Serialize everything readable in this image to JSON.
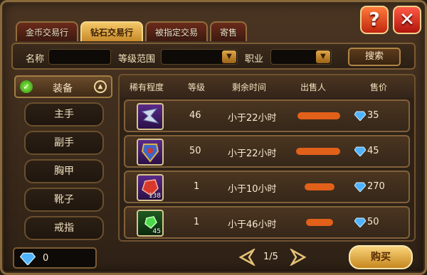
{
  "tabs": [
    {
      "label": "金币交易行",
      "active": false
    },
    {
      "label": "钻石交易行",
      "active": true
    },
    {
      "label": "被指定交易",
      "active": false
    },
    {
      "label": "寄售",
      "active": false
    }
  ],
  "top_buttons": {
    "help": "?",
    "close": "✕"
  },
  "search": {
    "name_label": "名称",
    "name_value": "",
    "level_label": "等级范围",
    "level_value": "",
    "job_label": "职业",
    "job_value": "",
    "search_button": "搜索"
  },
  "sidebar": {
    "category": "装备",
    "items": [
      "主手",
      "副手",
      "胸甲",
      "靴子",
      "戒指"
    ]
  },
  "table": {
    "headers": [
      "稀有程度",
      "等级",
      "剩余时间",
      "出售人",
      "售价"
    ],
    "rows": [
      {
        "icon": "blade-icon",
        "icon_count": "",
        "level": "46",
        "time": "小于22小时",
        "price": "35"
      },
      {
        "icon": "armor-icon",
        "icon_count": "",
        "level": "50",
        "time": "小于22小时",
        "price": "45"
      },
      {
        "icon": "ruby-icon",
        "icon_count": "138",
        "level": "1",
        "time": "小于10小时",
        "price": "270"
      },
      {
        "icon": "emerald-icon",
        "icon_count": "45",
        "level": "1",
        "time": "小于46小时",
        "price": "50"
      }
    ]
  },
  "footer": {
    "balance": "0",
    "page": "1/5",
    "buy_button": "购买"
  },
  "colors": {
    "accent": "#f4c766",
    "frame": "#8a6a3b",
    "seller_redaction": "#ff6a1a",
    "gem": "#4fb3ff"
  }
}
